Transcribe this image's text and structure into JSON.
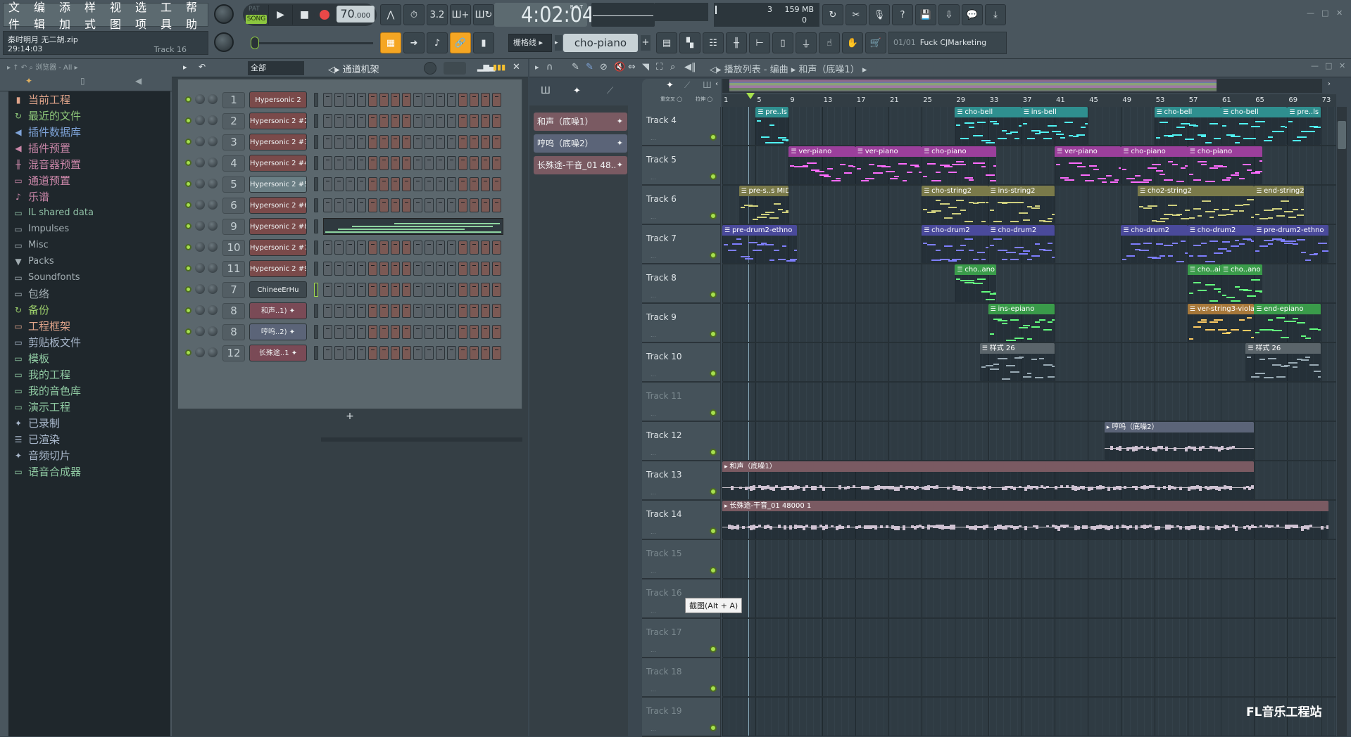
{
  "menu": [
    "文件",
    "编辑",
    "添加",
    "样式",
    "视图",
    "选项",
    "工具",
    "帮助"
  ],
  "project": {
    "name": "秦时明月 无二胡.zip",
    "time": "29:14:03",
    "hint_track": "Track 16"
  },
  "transport": {
    "pat_label": "PAT",
    "song_label": "SONG",
    "mode": "SONG",
    "tempo": "70",
    "tempo_dec": ".000",
    "clock": "4:02:04",
    "clock_label": "B:S:T"
  },
  "cpu": {
    "poly": "3",
    "mem": "159 MB",
    "voices": "0"
  },
  "toolbar2": {
    "snap": "栅格线",
    "pattern": "cho-piano",
    "hint_count": "01/01",
    "hint_text": "Fuck CJMarketing"
  },
  "browser": {
    "path": "浏览器 - All",
    "items": [
      {
        "label": "当前工程",
        "icon": "project-icon",
        "color": "#e0a48a"
      },
      {
        "label": "最近的文件",
        "icon": "recent-folder-icon",
        "color": "#8fc97a"
      },
      {
        "label": "插件数据库",
        "icon": "plugin-db-icon",
        "color": "#7ea3d8"
      },
      {
        "label": "插件预置",
        "icon": "plugin-preset-icon",
        "color": "#c986a8"
      },
      {
        "label": "混音器预置",
        "icon": "mixer-preset-icon",
        "color": "#c986a8"
      },
      {
        "label": "通道预置",
        "icon": "channel-preset-icon",
        "color": "#c986a8"
      },
      {
        "label": "乐谱",
        "icon": "score-icon",
        "color": "#c986a8"
      },
      {
        "label": "IL shared data",
        "icon": "folder-icon",
        "color": "#8fbfa5",
        "en": true
      },
      {
        "label": "Impulses",
        "icon": "folder-icon",
        "color": "#a2adb2",
        "en": true
      },
      {
        "label": "Misc",
        "icon": "folder-icon",
        "color": "#a2adb2",
        "en": true
      },
      {
        "label": "Packs",
        "icon": "packs-icon",
        "color": "#a2adb2",
        "en": true
      },
      {
        "label": "Soundfonts",
        "icon": "folder-icon",
        "color": "#a2adb2",
        "en": true
      },
      {
        "label": "包络",
        "icon": "folder-icon",
        "color": "#a2adb2"
      },
      {
        "label": "备份",
        "icon": "backup-folder-icon",
        "color": "#9ccf6b"
      },
      {
        "label": "工程框架",
        "icon": "folder-icon",
        "color": "#e0a48a"
      },
      {
        "label": "剪贴板文件",
        "icon": "folder-icon",
        "color": "#a9b8cc"
      },
      {
        "label": "模板",
        "icon": "folder-icon",
        "color": "#8fc9a2"
      },
      {
        "label": "我的工程",
        "icon": "folder-icon",
        "color": "#8fc9a2"
      },
      {
        "label": "我的音色库",
        "icon": "folder-icon",
        "color": "#8fc9a2"
      },
      {
        "label": "演示工程",
        "icon": "folder-icon",
        "color": "#8fc9a2"
      },
      {
        "label": "已录制",
        "icon": "audio-icon",
        "color": "#a9b8cc"
      },
      {
        "label": "已渲染",
        "icon": "rendered-icon",
        "color": "#a9b8cc"
      },
      {
        "label": "音频切片",
        "icon": "audio-icon",
        "color": "#a9b8cc"
      },
      {
        "label": "语音合成器",
        "icon": "folder-icon",
        "color": "#8fc9a2"
      }
    ]
  },
  "rack": {
    "filter": "全部",
    "title": "通道机架",
    "channels": [
      {
        "num": "1",
        "name": "Hypersonic 2",
        "color": "#7a4a4a"
      },
      {
        "num": "2",
        "name": "Hypersonic 2 #2",
        "color": "#7a4a4a"
      },
      {
        "num": "3",
        "name": "Hypersonic 2 #3",
        "color": "#7a4a4a"
      },
      {
        "num": "4",
        "name": "Hypersonic 2 #4",
        "color": "#7a4a4a"
      },
      {
        "num": "5",
        "name": "Hypersonic 2 #5",
        "color": "#6a7e84"
      },
      {
        "num": "6",
        "name": "Hypersonic 2 #6",
        "color": "#7a4a4a"
      },
      {
        "num": "9",
        "name": "Hypersonic 2 #8",
        "color": "#7a4a4a",
        "pianoroll": true
      },
      {
        "num": "10",
        "name": "Hypersonic 2 #7",
        "color": "#7a4a4a"
      },
      {
        "num": "11",
        "name": "Hypersonic 2 #9",
        "color": "#7a4a4a"
      },
      {
        "num": "7",
        "name": "ChineeErHu",
        "color": "#3e484e",
        "selected": true
      },
      {
        "num": "8",
        "name": "和声..1)",
        "color": "#7a4a56",
        "audio": true
      },
      {
        "num": "8",
        "name": "哼呜..2)",
        "color": "#5b6478",
        "audio": true
      },
      {
        "num": "12",
        "name": "长殊途..1",
        "color": "#7a4a56",
        "audio": true
      }
    ],
    "add_label": "+"
  },
  "picker": {
    "items": [
      {
        "label": "和声（底噪1）",
        "color": "#7a5a62"
      },
      {
        "label": "哼呜（底噪2）",
        "color": "#5b6478"
      },
      {
        "label": "长殊途-干音_01 48..",
        "color": "#7a5a62"
      }
    ]
  },
  "playlist": {
    "title": "播放列表 - 编曲",
    "crumb": "和声（底噪1）",
    "ruler": [
      "1",
      "5",
      "9",
      "13",
      "17",
      "21",
      "25",
      "29",
      "33",
      "37",
      "41",
      "45",
      "49",
      "53",
      "57",
      "61",
      "65",
      "69",
      "73"
    ],
    "tracks": [
      {
        "name": "Track 4",
        "clips": [
          {
            "label": "pre..ls",
            "color": "#2f8f8f",
            "start": 5,
            "len": 4
          },
          {
            "label": "cho-bell",
            "color": "#2f8f8f",
            "start": 29,
            "len": 8
          },
          {
            "label": "ins-bell",
            "color": "#2f8f8f",
            "start": 37,
            "len": 8
          },
          {
            "label": "cho-bell",
            "color": "#2f8f8f",
            "start": 53,
            "len": 8
          },
          {
            "label": "cho-bell",
            "color": "#2f8f8f",
            "start": 61,
            "len": 8
          },
          {
            "label": "pre..ls",
            "color": "#2f8f8f",
            "start": 69,
            "len": 4
          }
        ]
      },
      {
        "name": "Track 5",
        "clips": [
          {
            "label": "ver-piano",
            "color": "#9b3f9b",
            "start": 9,
            "len": 8
          },
          {
            "label": "ver-piano",
            "color": "#9b3f9b",
            "start": 17,
            "len": 8
          },
          {
            "label": "cho-piano",
            "color": "#9b3f9b",
            "start": 25,
            "len": 9
          },
          {
            "label": "ver-piano",
            "color": "#9b3f9b",
            "start": 41,
            "len": 8
          },
          {
            "label": "cho-piano",
            "color": "#9b3f9b",
            "start": 49,
            "len": 8
          },
          {
            "label": "cho-piano",
            "color": "#9b3f9b",
            "start": 57,
            "len": 9
          }
        ]
      },
      {
        "name": "Track 6",
        "clips": [
          {
            "label": "pre-s..s MID",
            "color": "#7a7a4a",
            "start": 3,
            "len": 6
          },
          {
            "label": "cho-string2",
            "color": "#7a7a4a",
            "start": 25,
            "len": 8
          },
          {
            "label": "ins-string2",
            "color": "#7a7a4a",
            "start": 33,
            "len": 8
          },
          {
            "label": "cho2-string2",
            "color": "#7a7a4a",
            "start": 51,
            "len": 14
          },
          {
            "label": "end-string2",
            "color": "#7a7a4a",
            "start": 65,
            "len": 6
          }
        ]
      },
      {
        "name": "Track 7",
        "clips": [
          {
            "label": "pre-drum2-ethno",
            "color": "#4a4a9b",
            "start": 1,
            "len": 9
          },
          {
            "label": "cho-drum2",
            "color": "#4a4a9b",
            "start": 25,
            "len": 8
          },
          {
            "label": "cho-drum2",
            "color": "#4a4a9b",
            "start": 33,
            "len": 8
          },
          {
            "label": "cho-drum2",
            "color": "#4a4a9b",
            "start": 49,
            "len": 8
          },
          {
            "label": "cho-drum2",
            "color": "#4a4a9b",
            "start": 57,
            "len": 8
          },
          {
            "label": "pre-drum2-ethno",
            "color": "#4a4a9b",
            "start": 65,
            "len": 9
          }
        ]
      },
      {
        "name": "Track 8",
        "clips": [
          {
            "label": "cho..ano",
            "color": "#3a9b4a",
            "start": 29,
            "len": 5
          },
          {
            "label": "cho..ai",
            "color": "#3a9b4a",
            "start": 57,
            "len": 4
          },
          {
            "label": "cho..ano",
            "color": "#3a9b4a",
            "start": 61,
            "len": 5
          }
        ]
      },
      {
        "name": "Track 9",
        "clips": [
          {
            "label": "ins-epiano",
            "color": "#3a9b4a",
            "start": 33,
            "len": 8
          },
          {
            "label": "ver-string3-viola",
            "color": "#a7783a",
            "start": 57,
            "len": 8
          },
          {
            "label": "end-epiano",
            "color": "#3a9b4a",
            "start": 65,
            "len": 8
          }
        ]
      },
      {
        "name": "Track 10",
        "clips": [
          {
            "label": "样式 26",
            "color": "#5a646a",
            "start": 32,
            "len": 9
          },
          {
            "label": "样式 26",
            "color": "#5a646a",
            "start": 64,
            "len": 9
          }
        ]
      },
      {
        "name": "Track 11",
        "dim": true,
        "clips": []
      },
      {
        "name": "Track 12",
        "clips": [
          {
            "label": "哼呜（底噪2）",
            "color": "#5b6478",
            "start": 47,
            "len": 18,
            "audio": true
          }
        ]
      },
      {
        "name": "Track 13",
        "clips": [
          {
            "label": "和声（底噪1）",
            "color": "#7a5a62",
            "start": 1,
            "len": 64,
            "audio": true
          }
        ]
      },
      {
        "name": "Track 14",
        "clips": [
          {
            "label": "长殊途-干音_01 48000 1",
            "color": "#7a5a62",
            "start": 1,
            "len": 73,
            "audio": true
          }
        ]
      },
      {
        "name": "Track 15",
        "dim": true,
        "clips": []
      },
      {
        "name": "Track 16",
        "dim": true,
        "clips": []
      },
      {
        "name": "Track 17",
        "dim": true,
        "clips": []
      },
      {
        "name": "Track 18",
        "dim": true,
        "clips": []
      },
      {
        "name": "Track 19",
        "dim": true,
        "clips": []
      }
    ],
    "tooltip": "截图(Alt + A)"
  },
  "watermark": "FL音乐工程站"
}
